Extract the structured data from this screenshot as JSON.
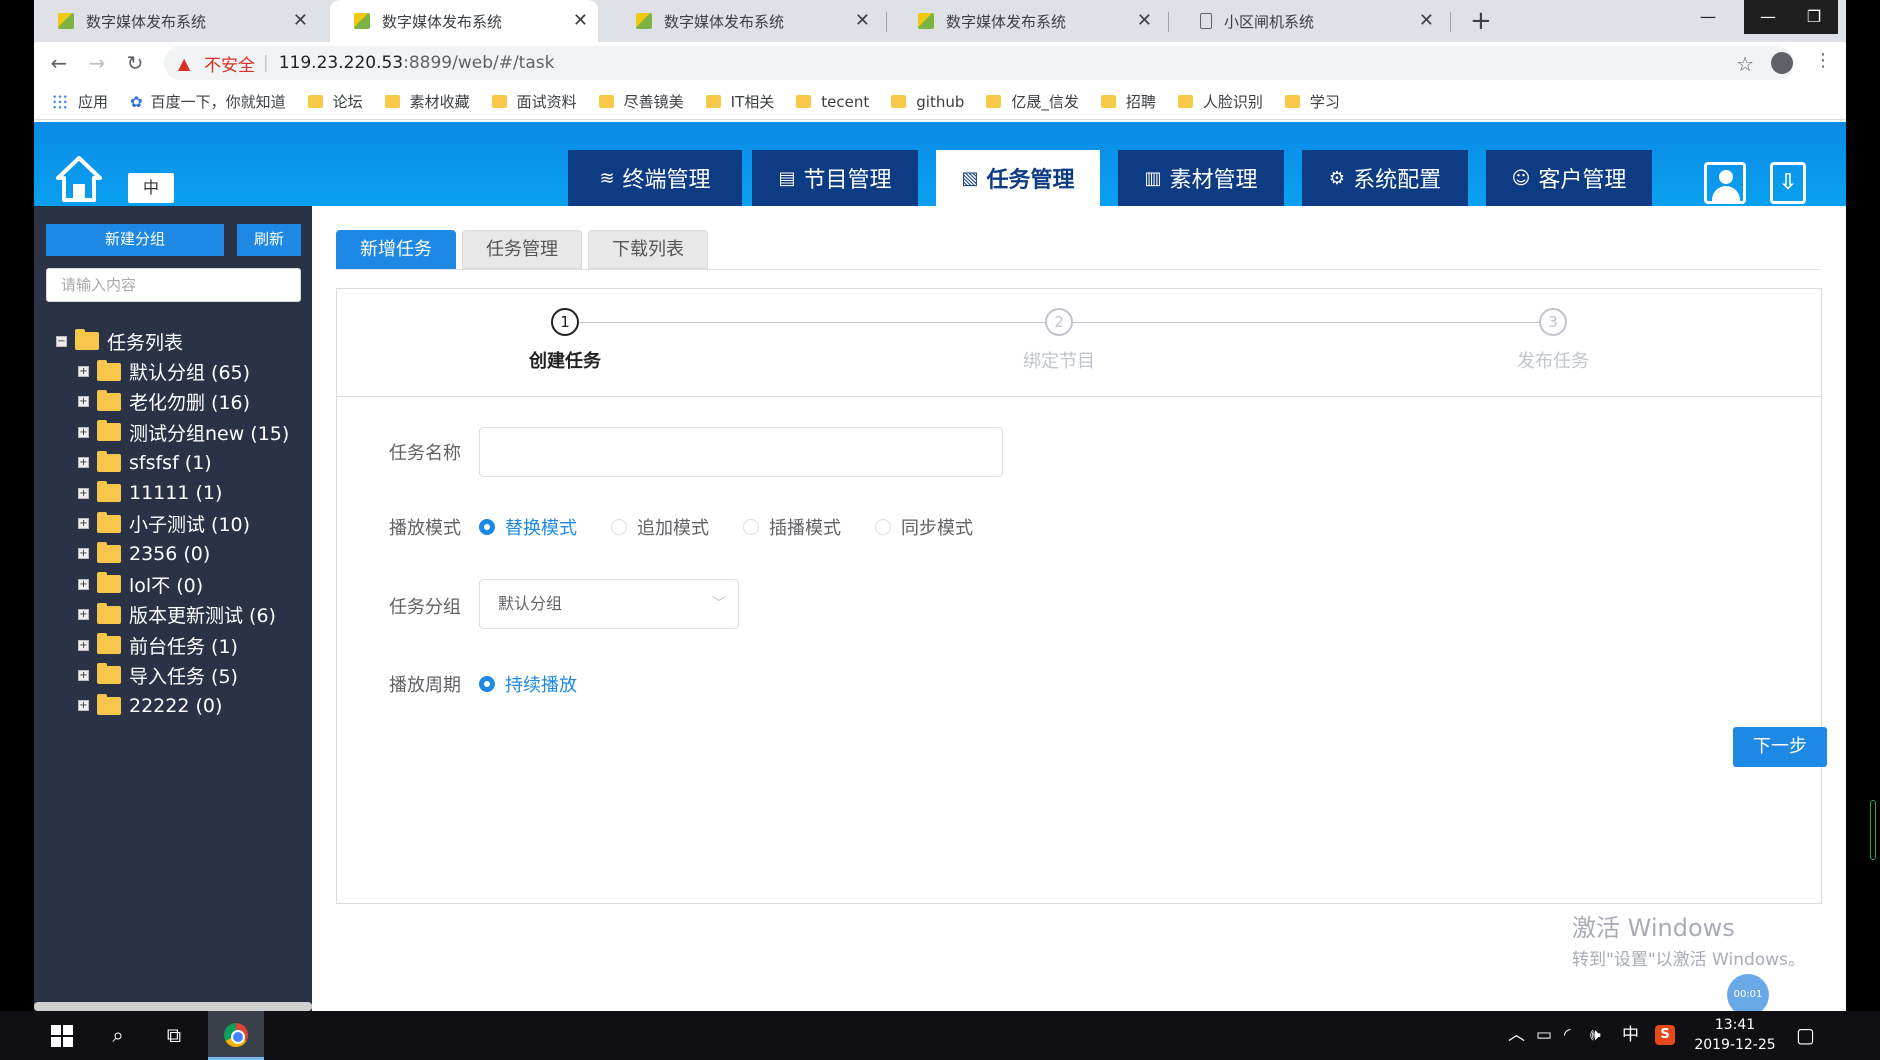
{
  "browser": {
    "tabs": [
      {
        "title": "数字媒体发布系统",
        "icon": "media-favicon"
      },
      {
        "title": "数字媒体发布系统",
        "icon": "media-favicon",
        "active": true
      },
      {
        "title": "数字媒体发布系统",
        "icon": "media-favicon"
      },
      {
        "title": "数字媒体发布系统",
        "icon": "media-favicon"
      },
      {
        "title": "小区闸机系统",
        "icon": "document-favicon"
      }
    ],
    "new_tab": "+",
    "insecure_label": "不安全",
    "url_host": "119.23.220.53",
    "url_rest": ":8899/web/#/task",
    "bookmarks": [
      {
        "label": "应用",
        "icon": "apps-icon"
      },
      {
        "label": "百度一下，你就知道",
        "icon": "baidu-icon"
      },
      {
        "label": "论坛",
        "icon": "folder-icon"
      },
      {
        "label": "素材收藏",
        "icon": "folder-icon"
      },
      {
        "label": "面试资料",
        "icon": "folder-icon"
      },
      {
        "label": "尽善镜美",
        "icon": "folder-icon"
      },
      {
        "label": "IT相关",
        "icon": "folder-icon"
      },
      {
        "label": "tecent",
        "icon": "folder-icon"
      },
      {
        "label": "github",
        "icon": "folder-icon"
      },
      {
        "label": "亿晟_信发",
        "icon": "folder-icon"
      },
      {
        "label": "招聘",
        "icon": "folder-icon"
      },
      {
        "label": "人脸识别",
        "icon": "folder-icon"
      },
      {
        "label": "学习",
        "icon": "folder-icon"
      }
    ]
  },
  "header": {
    "lang": "中",
    "nav": [
      {
        "label": "终端管理",
        "icon": "layers-icon"
      },
      {
        "label": "节目管理",
        "icon": "program-icon"
      },
      {
        "label": "任务管理",
        "icon": "task-icon",
        "active": true
      },
      {
        "label": "素材管理",
        "icon": "material-icon"
      },
      {
        "label": "系统配置",
        "icon": "config-icon"
      },
      {
        "label": "客户管理",
        "icon": "customer-icon"
      }
    ]
  },
  "sidebar": {
    "new_group": "新建分组",
    "refresh": "刷新",
    "search_placeholder": "请输入内容",
    "root": "任务列表",
    "groups": [
      "默认分组 (65)",
      "老化勿删 (16)",
      "测试分组new (15)",
      "sfsfsf (1)",
      "11111 (1)",
      "小子测试 (10)",
      "2356 (0)",
      "lol不 (0)",
      "版本更新测试 (6)",
      "前台任务 (1)",
      "导入任务 (5)",
      "22222 (0)"
    ]
  },
  "main": {
    "subtabs": [
      "新增任务",
      "任务管理",
      "下载列表"
    ],
    "steps": [
      {
        "num": "1",
        "label": "创建任务",
        "done": true
      },
      {
        "num": "2",
        "label": "绑定节目",
        "done": false
      },
      {
        "num": "3",
        "label": "发布任务",
        "done": false
      }
    ],
    "form": {
      "name_label": "任务名称",
      "name_value": "",
      "mode_label": "播放模式",
      "modes": [
        {
          "label": "替换模式",
          "checked": true
        },
        {
          "label": "追加模式",
          "checked": false
        },
        {
          "label": "插播模式",
          "checked": false
        },
        {
          "label": "同步模式",
          "checked": false
        }
      ],
      "group_label": "任务分组",
      "group_value": "默认分组",
      "period_label": "播放周期",
      "period_value": "持续播放"
    },
    "next_button": "下一步"
  },
  "watermark": {
    "line1": "激活 Windows",
    "line2": "转到\"设置\"以激活 Windows。"
  },
  "recording_badge": "00:01",
  "taskbar": {
    "tray_ime": "中",
    "time": "13:41",
    "date": "2019-12-25"
  },
  "colors": {
    "accent": "#1e88e5",
    "nav_dark": "#0d3c84",
    "header_blue": "#0a8be6",
    "sidebar_bg": "#2a3346"
  }
}
